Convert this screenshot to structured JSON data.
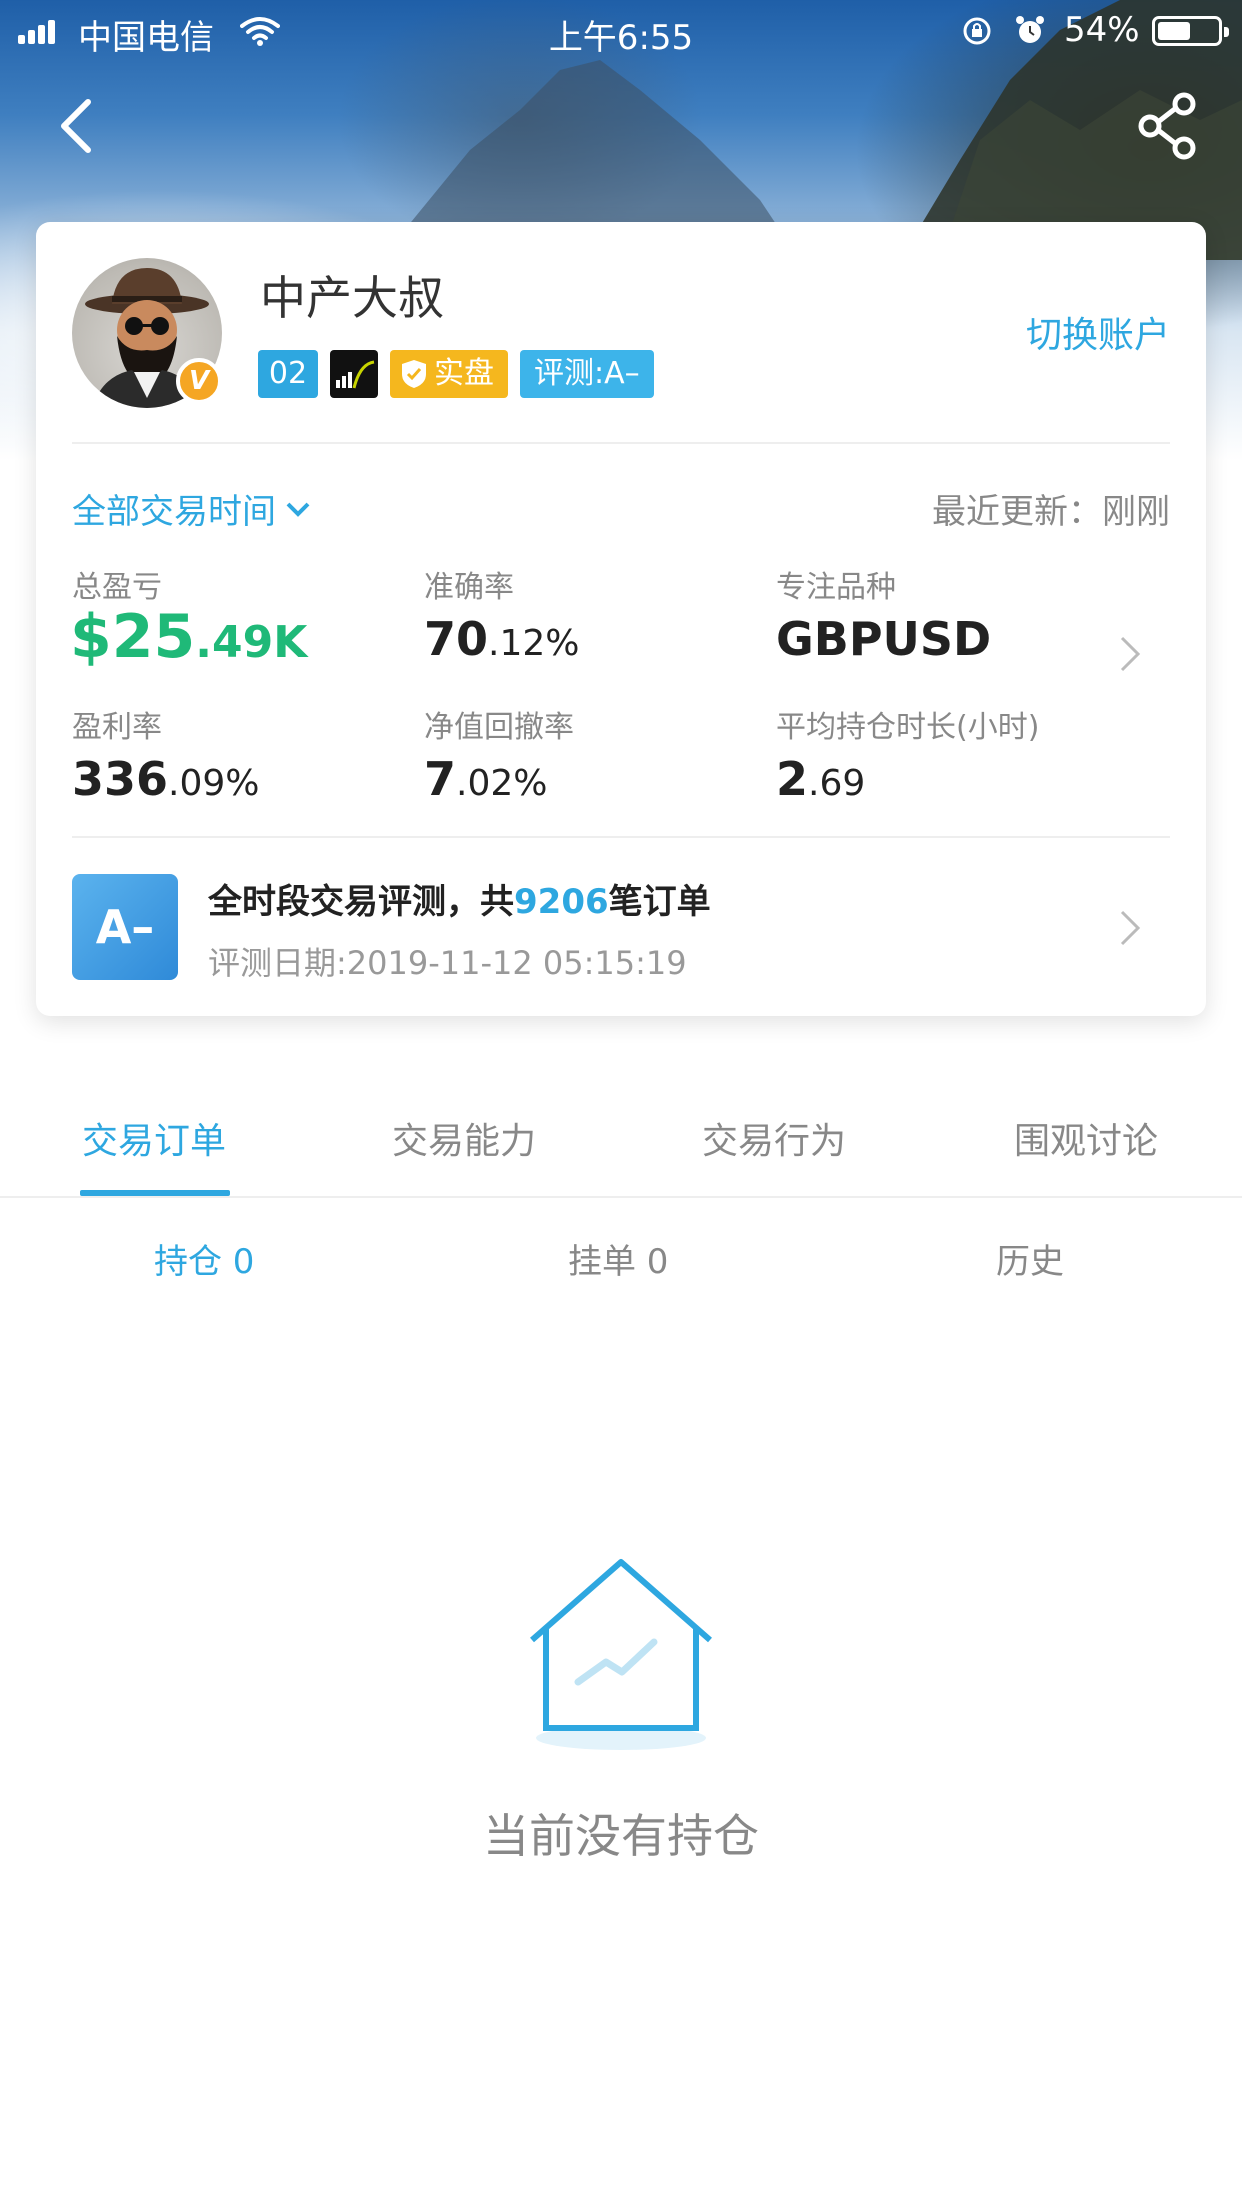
{
  "status_bar": {
    "carrier": "中国电信",
    "time": "上午6:55",
    "battery": "54%",
    "battery_level": 0.54
  },
  "icons": {
    "back": "chevron-left-icon",
    "share": "share-icon",
    "wifi": "wifi-icon",
    "signal": "signal-icon",
    "rotation_lock": "rotation-lock-icon",
    "alarm": "alarm-icon",
    "battery": "battery-icon",
    "verified": "verified-v-icon",
    "shield": "shield-check-icon",
    "dropdown": "chevron-down-icon",
    "empty": "house-chart-icon"
  },
  "profile": {
    "name": "中产大叔",
    "verified_mark": "V",
    "badges": {
      "level": "02",
      "real": "实盘",
      "rating": "评测:A–"
    },
    "switch_account": "切换账户"
  },
  "filter": {
    "label": "全部交易时间",
    "last_update": "最近更新：刚刚"
  },
  "stats": {
    "total_pl": {
      "label": "总盈亏",
      "big": "$25",
      "small": ".49K"
    },
    "accuracy": {
      "label": "准确率",
      "big": "70",
      "small": ".12%"
    },
    "focus_symbol": {
      "label": "专注品种",
      "value": "GBPUSD"
    },
    "profit_rate": {
      "label": "盈利率",
      "big": "336",
      "small": ".09%"
    },
    "drawdown": {
      "label": "净值回撤率",
      "big": "7",
      "small": ".02%"
    },
    "avg_hold": {
      "label": "平均持仓时长(小时)",
      "big": "2",
      "small": ".69"
    }
  },
  "evaluation": {
    "grade": "A–",
    "title_prefix": "全时段交易评测，共",
    "order_count": "9206",
    "title_suffix": "笔订单",
    "date": "评测日期:2019-11-12 05:15:19"
  },
  "tabs": [
    "交易订单",
    "交易能力",
    "交易行为",
    "围观讨论"
  ],
  "subtabs": [
    "持仓 0",
    "挂单 0",
    "历史"
  ],
  "empty_message": "当前没有持仓",
  "colors": {
    "accent": "#2ea7e0",
    "profit_green": "#1fb978",
    "badge_orange": "#f5b71e"
  }
}
